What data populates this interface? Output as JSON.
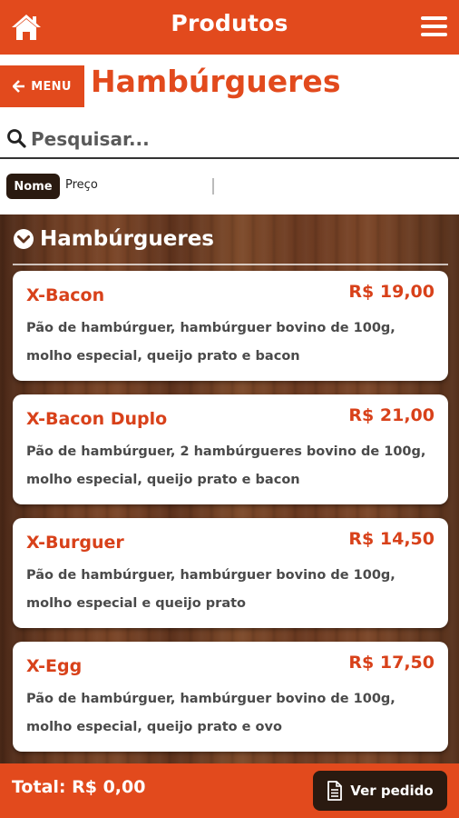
{
  "header": {
    "title": "Produtos",
    "home_icon": "home-icon",
    "menu_icon": "hamburger-menu-icon"
  },
  "nav": {
    "back_label": "MENU",
    "page_title": "Hambúrgueres"
  },
  "search": {
    "placeholder": "Pesquisar...",
    "value": ""
  },
  "sort": {
    "options": [
      "Nome",
      "Preço"
    ],
    "selected": "Nome"
  },
  "category": {
    "title": "Hambúrgueres"
  },
  "products": [
    {
      "name": "X-Bacon",
      "price": "R$ 19,00",
      "description": "Pão de hambúrguer, hambúrguer bovino de 100g, molho especial, queijo prato e bacon"
    },
    {
      "name": "X-Bacon Duplo",
      "price": "R$ 21,00",
      "description": "Pão de hambúrguer, 2 hambúrgueres bovino de 100g, molho especial, queijo prato e bacon"
    },
    {
      "name": "X-Burguer",
      "price": "R$ 14,50",
      "description": "Pão de hambúrguer, hambúrguer bovino de 100g, molho especial e queijo prato"
    },
    {
      "name": "X-Egg",
      "price": "R$ 17,50",
      "description": "Pão de hambúrguer, hambúrguer bovino de 100g, molho especial, queijo prato e ovo"
    }
  ],
  "footer": {
    "total": "Total: R$ 0,00",
    "order_button": "Ver pedido"
  },
  "colors": {
    "accent": "#e24a1d",
    "dark": "#2a1a10",
    "price": "#d8411a"
  }
}
